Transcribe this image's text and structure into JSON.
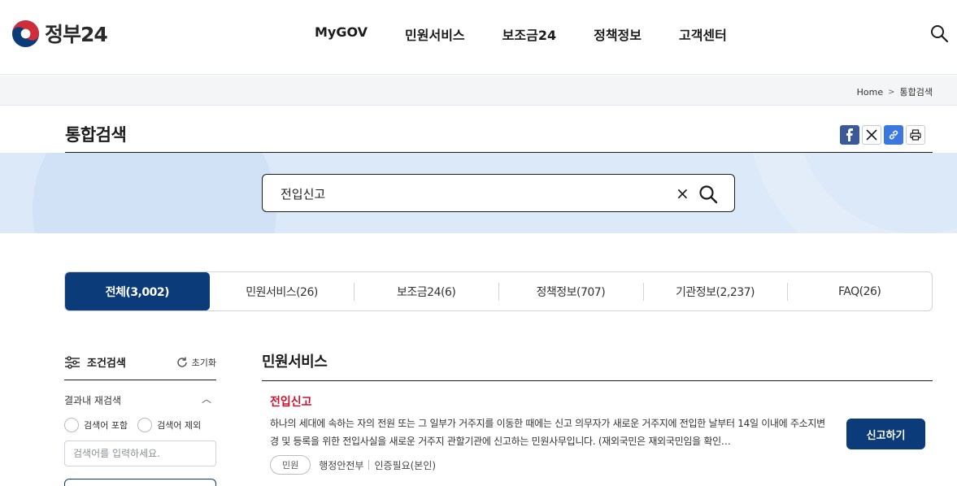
{
  "header": {
    "logo_text": "정부24",
    "nav": [
      "MyGOV",
      "민원서비스",
      "보조금24",
      "정책정보",
      "고객센터"
    ]
  },
  "breadcrumb": {
    "home": "Home",
    "current": "통합검색"
  },
  "page": {
    "title": "통합검색"
  },
  "search": {
    "query": "전입신고",
    "clear_icon": "×"
  },
  "tabs": [
    {
      "label": "전체(3,002)",
      "active": true
    },
    {
      "label": "민원서비스(26)"
    },
    {
      "label": "보조금24(6)"
    },
    {
      "label": "정책정보(707)"
    },
    {
      "label": "기관정보(2,237)"
    },
    {
      "label": "FAQ(26)"
    }
  ],
  "filter": {
    "title": "조건검색",
    "reset_label": "초기화",
    "refine_label": "결과내 재검색",
    "include_label": "검색어 포함",
    "exclude_label": "검색어 제외",
    "input_placeholder": "검색어를 입력하세요."
  },
  "results": {
    "section_title": "민원서비스",
    "item": {
      "title": "전입신고",
      "description": "하나의 세대에 속하는 자의 전원 또는 그 일부가 거주지를 이동한 때에는 신고 의무자가 새로운 거주지에 전입한 날부터 14일 이내에 주소지변경 및 등록을 위한 전입사실을 새로운 거주지 관할기관에 신고하는 민원사무입니다. (재외국민은 재외국민임을 확인…",
      "badge": "민원",
      "agency": "행정안전부",
      "auth": "인증필요(본인)",
      "action_label": "신고하기"
    }
  },
  "colors": {
    "primary": "#0b3b78",
    "result_title": "#c8102e",
    "banner_bg": "#dce9f8"
  }
}
